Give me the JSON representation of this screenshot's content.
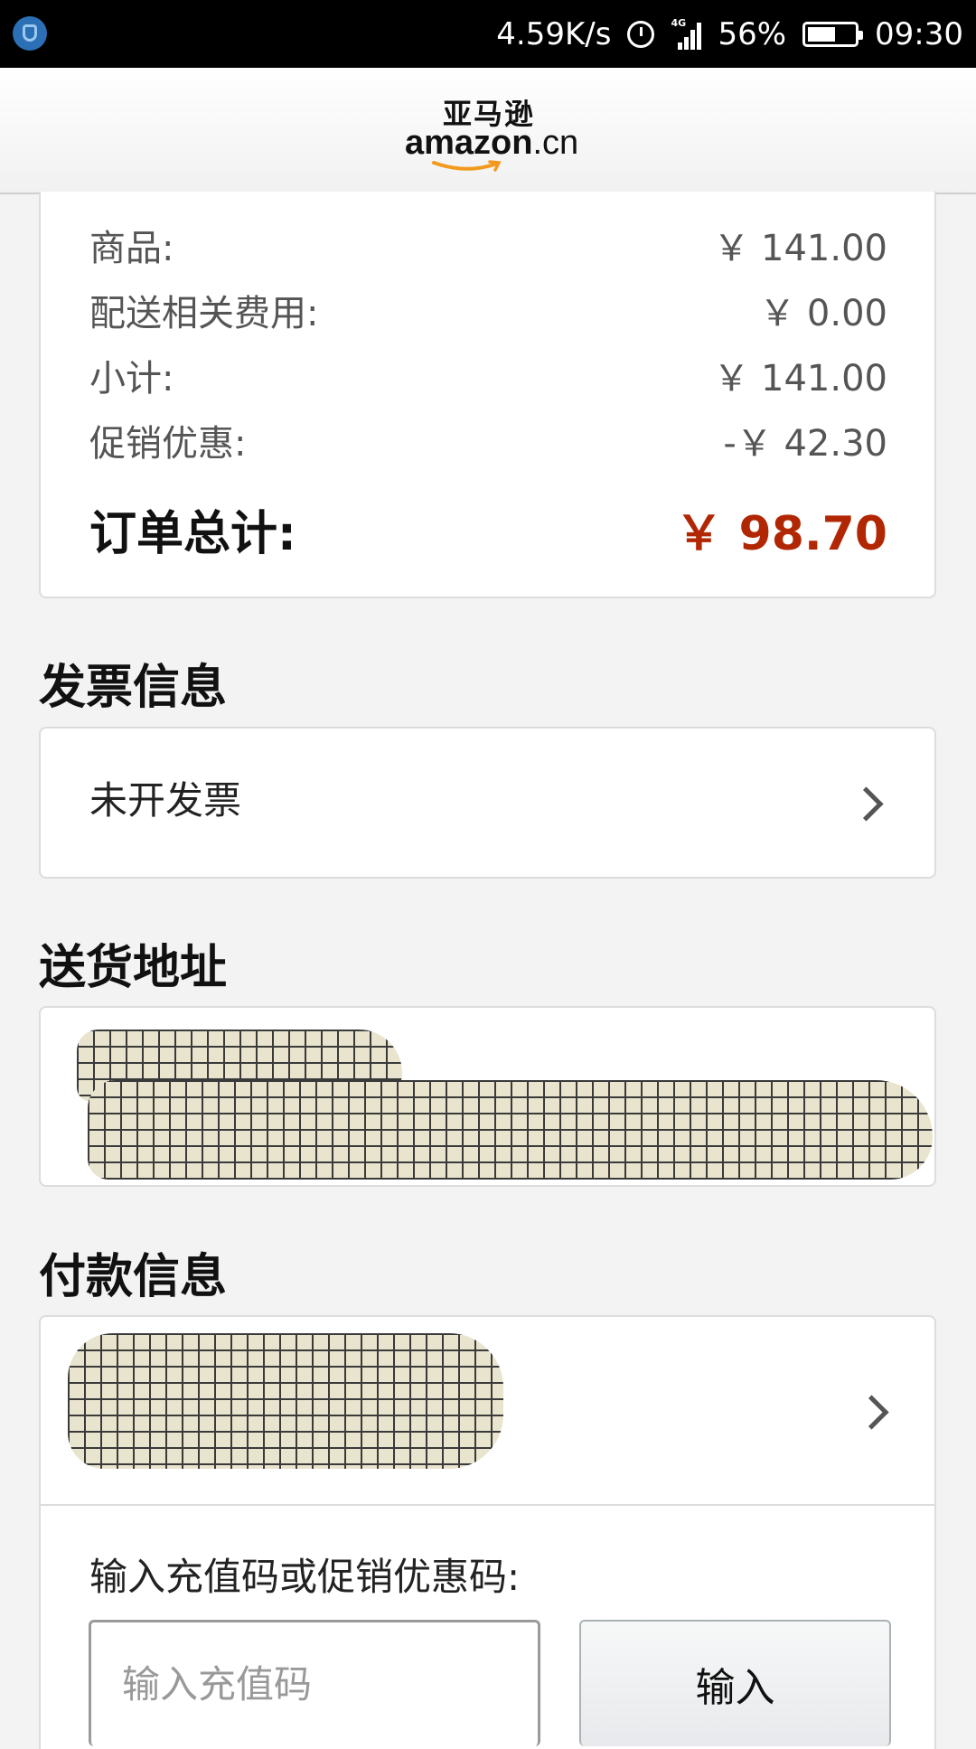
{
  "status_bar": {
    "net_speed": "4.59K/s",
    "network": "4G",
    "battery": "56%",
    "time": "09:30"
  },
  "header": {
    "logo_cn": "亚马逊",
    "logo_en": "amazon",
    "logo_domain": ".cn"
  },
  "summary": {
    "rows": [
      {
        "label": "商品:",
        "value": "￥ 141.00"
      },
      {
        "label": "配送相关费用:",
        "value": "￥ 0.00"
      },
      {
        "label": "小计:",
        "value": "￥ 141.00"
      },
      {
        "label": "促销优惠:",
        "value": "-￥ 42.30"
      }
    ],
    "total_label": "订单总计:",
    "total_value": "￥ 98.70"
  },
  "invoice": {
    "title": "发票信息",
    "value": "未开发票"
  },
  "address": {
    "title": "送货地址"
  },
  "payment": {
    "title": "付款信息",
    "promo_label": "输入充值码或促销优惠码:",
    "promo_placeholder": "输入充值码",
    "promo_button": "输入"
  },
  "colors": {
    "total_price": "#b12704",
    "status_bar": "#000000",
    "background": "#f3f3f3"
  }
}
